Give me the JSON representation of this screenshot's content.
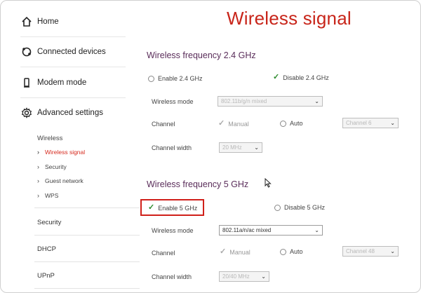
{
  "page": {
    "title": "Wireless signal"
  },
  "sidebar": {
    "main": [
      {
        "label": "Home",
        "icon": "home-icon"
      },
      {
        "label": "Connected devices",
        "icon": "devices-icon"
      },
      {
        "label": "Modem mode",
        "icon": "modem-icon"
      },
      {
        "label": "Advanced settings",
        "icon": "gear-icon"
      }
    ],
    "wireless_header": "Wireless",
    "wireless_items": [
      {
        "label": "Wireless signal",
        "active": true
      },
      {
        "label": "Security"
      },
      {
        "label": "Guest network"
      },
      {
        "label": "WPS"
      }
    ],
    "sections": [
      "Security",
      "DHCP",
      "UPnP"
    ]
  },
  "band24": {
    "title": "Wireless frequency 2.4 GHz",
    "enable_label": "Enable 2.4 GHz",
    "disable_label": "Disable 2.4 GHz",
    "selected": "disable",
    "mode_label": "Wireless mode",
    "mode_value": "802.11b/g/n mixed",
    "channel_label": "Channel",
    "manual_label": "Manual",
    "auto_label": "Auto",
    "channel_value": "Channel 6",
    "width_label": "Channel width",
    "width_value": "20 MHz"
  },
  "band5": {
    "title": "Wireless frequency 5 GHz",
    "enable_label": "Enable 5 GHz",
    "disable_label": "Disable 5 GHz",
    "selected": "enable",
    "mode_label": "Wireless mode",
    "mode_value": "802.11a/n/ac mixed",
    "channel_label": "Channel",
    "manual_label": "Manual",
    "auto_label": "Auto",
    "channel_value": "Channel 48",
    "width_label": "Channel width",
    "width_value": "20/40 MHz"
  },
  "colors": {
    "accent": "#c8251a",
    "highlight": "#d0201a",
    "check": "#2b8a2b"
  }
}
